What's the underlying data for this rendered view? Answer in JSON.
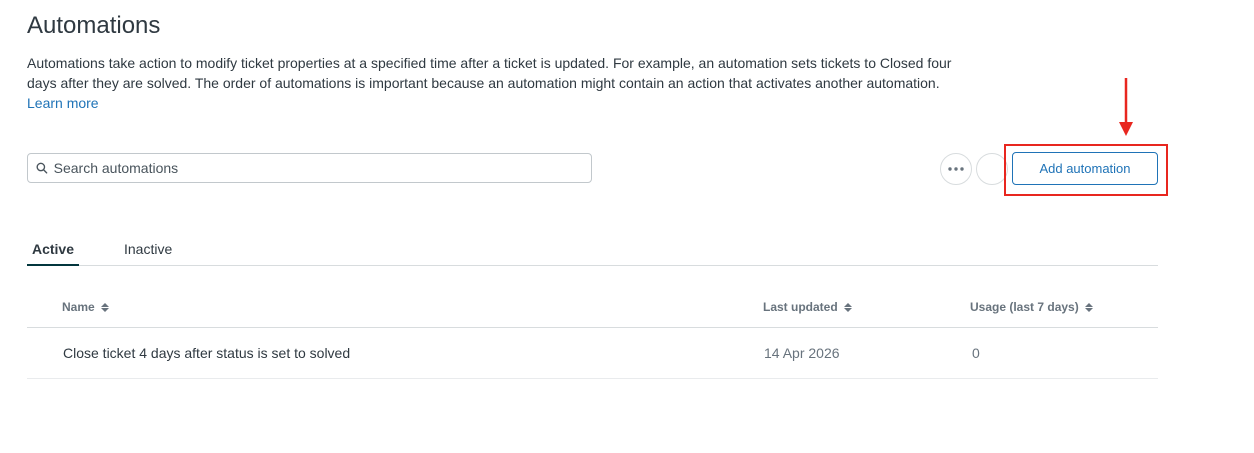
{
  "header": {
    "title": "Automations",
    "description": "Automations take action to modify ticket properties at a specified time after a ticket is updated. For example, an automation sets tickets to Closed four days after they are solved. The order of automations is important because an automation might contain an action that activates another automation.",
    "learn_more": "Learn more"
  },
  "toolbar": {
    "search_placeholder": "Search automations",
    "add_button": "Add automation",
    "more_icon": "ellipsis-icon"
  },
  "tabs": [
    {
      "label": "Active",
      "selected": true
    },
    {
      "label": "Inactive",
      "selected": false
    }
  ],
  "table": {
    "columns": [
      "Name",
      "Last updated",
      "Usage (last 7 days)"
    ],
    "rows": [
      {
        "name": "Close ticket 4 days after status is set to solved",
        "last_updated": "14 Apr 2026",
        "usage": "0"
      }
    ]
  },
  "colors": {
    "accent": "#1f73b7",
    "annotation": "#e8261f",
    "text": "#2f3941"
  }
}
